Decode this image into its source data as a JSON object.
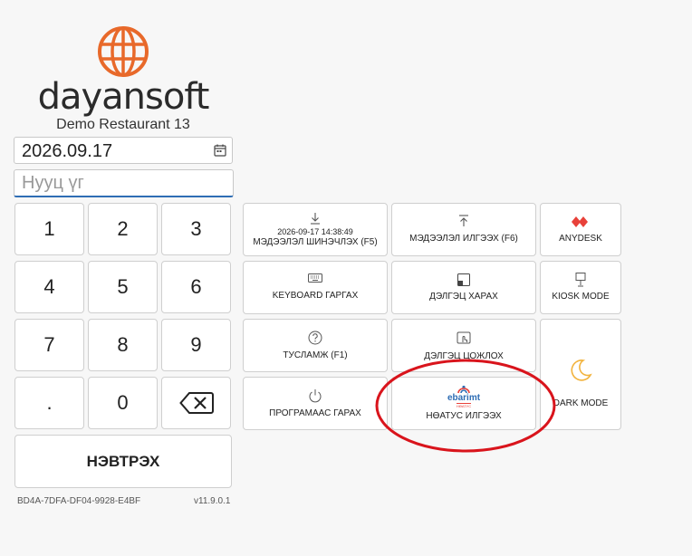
{
  "brand": {
    "name": "dayansoft",
    "restaurant": "Demo Restaurant 13"
  },
  "date": {
    "value": "2026.09.17"
  },
  "password": {
    "placeholder": "Нууц үг"
  },
  "keypad": {
    "keys": [
      "1",
      "2",
      "3",
      "4",
      "5",
      "6",
      "7",
      "8",
      "9",
      ".",
      "0"
    ],
    "backspace_icon": "backspace-icon",
    "enter_label": "НЭВТРЭХ"
  },
  "footer": {
    "device_id": "BD4A-7DFA-DF04-9928-E4BF",
    "version": "v11.9.0.1"
  },
  "functions": {
    "update": {
      "timestamp": "2026-09-17 14:38:49",
      "label": "МЭДЭЭЛЭЛ ШИНЭЧЛЭХ (F5)",
      "icon": "download-icon"
    },
    "send": {
      "label": "МЭДЭЭЛЭЛ ИЛГЭЭХ (F6)",
      "icon": "upload-icon"
    },
    "anydesk": {
      "label": "ANYDESK",
      "icon": "anydesk-icon",
      "color": "#e8413a"
    },
    "keyboard": {
      "label": "KEYBOARD ГАРГАХ",
      "icon": "keyboard-icon"
    },
    "screen": {
      "label": "ДЭЛГЭЦ ХАРАХ",
      "icon": "screen-icon"
    },
    "kiosk": {
      "label": "KIOSK MODE",
      "icon": "kiosk-icon"
    },
    "help": {
      "label": "ТУСЛАМЖ (F1)",
      "icon": "help-icon"
    },
    "screen_lock": {
      "label": "ДЭЛГЭЦ ЦОЖЛОХ",
      "icon": "touch-icon"
    },
    "dark": {
      "label": "DARK MODE",
      "icon": "moon-icon",
      "color": "#f2b33d"
    },
    "exit": {
      "label": "ПРОГРАМААС ГАРАХ",
      "icon": "power-icon"
    },
    "ebarimt": {
      "logo_text": "ebarimt",
      "logo_sub": "НӨАТУС",
      "label": "НӨАТУС ИЛГЭЭХ",
      "icon": "ebarimt-logo"
    }
  },
  "colors": {
    "brand_orange": "#e8692a",
    "annotation_red": "#d9141c",
    "focus_blue": "#2e6db4"
  }
}
